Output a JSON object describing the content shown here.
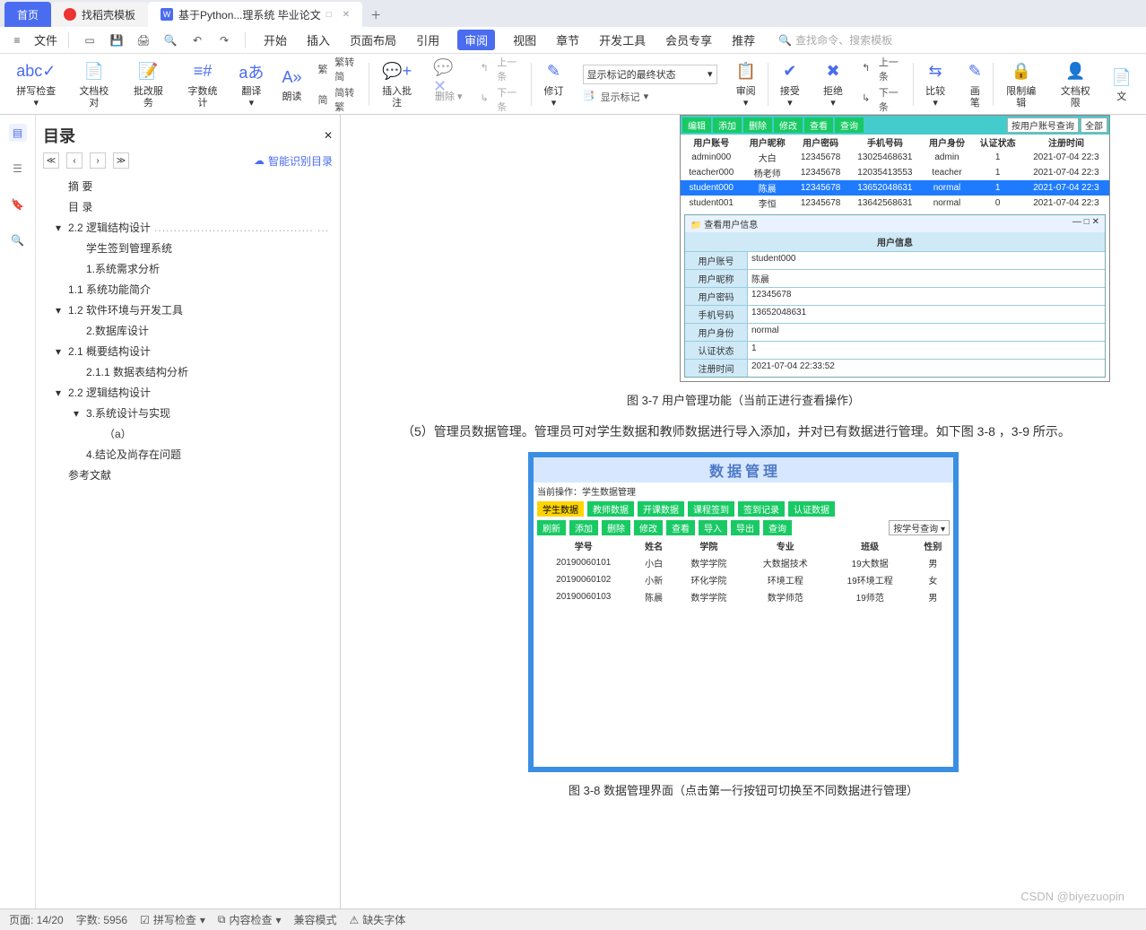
{
  "tabs": {
    "home": "首页",
    "docshell": "找稻壳模板",
    "active": "基于Python...理系统 毕业论文"
  },
  "menubar": {
    "file": "文件",
    "items": [
      "开始",
      "插入",
      "页面布局",
      "引用",
      "审阅",
      "视图",
      "章节",
      "开发工具",
      "会员专享",
      "推荐"
    ],
    "active_index": 4,
    "search_placeholder": "查找命令、搜索模板"
  },
  "ribbon": {
    "g1": "拼写检查",
    "g2": "文档校对",
    "g3": "批改服务",
    "g4": "字数统计",
    "g5": "翻译",
    "g6": "朗读",
    "trad1": "繁转简",
    "trad2": "简转繁",
    "g7": "插入批注",
    "g8": "删除",
    "prev_c": "上一条",
    "next_c": "下一条",
    "g9": "修订",
    "track_dd": "显示标记的最终状态",
    "show_mark": "显示标记",
    "g10": "审阅",
    "g11": "接受",
    "g12": "拒绝",
    "prev_r": "上一条",
    "next_r": "下一条",
    "g13": "比较",
    "g14": "画笔",
    "g15": "限制编辑",
    "g16": "文档权限",
    "g17": "文"
  },
  "outline": {
    "title": "目录",
    "auto": "智能识别目录",
    "items": [
      {
        "lvl": "l0",
        "txt": "摘    要",
        "arr": ""
      },
      {
        "lvl": "l0",
        "txt": "目    录",
        "arr": ""
      },
      {
        "lvl": "l1",
        "txt": "2.2 逻辑结构设计",
        "arr": "▾",
        "dash": true
      },
      {
        "lvl": "l2",
        "txt": "学生签到管理系统",
        "arr": ""
      },
      {
        "lvl": "l2",
        "txt": "1.系统需求分析",
        "arr": ""
      },
      {
        "lvl": "l1",
        "txt": "1.1 系统功能简介",
        "arr": ""
      },
      {
        "lvl": "l1",
        "txt": "1.2 软件环境与开发工具",
        "arr": "▾"
      },
      {
        "lvl": "l2",
        "txt": "2.数据库设计",
        "arr": ""
      },
      {
        "lvl": "l1",
        "txt": "2.1 概要结构设计",
        "arr": "▾"
      },
      {
        "lvl": "l2",
        "txt": "2.1.1 数据表结构分析",
        "arr": ""
      },
      {
        "lvl": "l1",
        "txt": "2.2 逻辑结构设计",
        "arr": "▾"
      },
      {
        "lvl": "l2",
        "txt": "3.系统设计与实现",
        "arr": "▾"
      },
      {
        "lvl": "l3",
        "txt": "（a）",
        "arr": ""
      },
      {
        "lvl": "l2",
        "txt": "4.结论及尚存在问题",
        "arr": ""
      },
      {
        "lvl": "l1",
        "txt": "参考文献",
        "arr": ""
      }
    ]
  },
  "doc": {
    "fig37_caption": "图 3-7  用户管理功能（当前正进行查看操作）",
    "para5": "（5）管理员数据管理。管理员可对学生数据和教师数据进行导入添加，并对已有数据进行管理。如下图 3-8 ，3-9  所示。",
    "fig38_caption": "图 3-8  数据管理界面（点击第一行按钮可切换至不同数据进行管理）"
  },
  "embed1": {
    "toolbar": [
      "编辑",
      "添加",
      "删除",
      "修改",
      "查看",
      "查询"
    ],
    "search_mode": "按用户账号查询",
    "all": "全部",
    "headers": [
      "用户账号",
      "用户昵称",
      "用户密码",
      "手机号码",
      "用户身份",
      "认证状态",
      "注册时间"
    ],
    "rows": [
      [
        "admin000",
        "大白",
        "12345678",
        "13025468631",
        "admin",
        "1",
        "2021-07-04 22:3"
      ],
      [
        "teacher000",
        "杨老师",
        "12345678",
        "12035413553",
        "teacher",
        "1",
        "2021-07-04 22:3"
      ],
      [
        "student000",
        "陈晨",
        "12345678",
        "13652048631",
        "normal",
        "1",
        "2021-07-04 22:3"
      ],
      [
        "student001",
        "李恒",
        "12345678",
        "13642568631",
        "normal",
        "0",
        "2021-07-04 22:3"
      ]
    ],
    "selected_row": 2,
    "dialog_title_bar": "查看用户信息",
    "dialog_title": "用户信息",
    "fields": [
      [
        "用户账号",
        "student000"
      ],
      [
        "用户昵称",
        "陈晨"
      ],
      [
        "用户密码",
        "12345678"
      ],
      [
        "手机号码",
        "13652048631"
      ],
      [
        "用户身份",
        "normal"
      ],
      [
        "认证状态",
        "1"
      ],
      [
        "注册时间",
        "2021-07-04 22:33:52"
      ]
    ]
  },
  "embed2": {
    "banner": "数 据 管 理",
    "info": "当前操作：学生数据管理",
    "tabs": [
      "学生数据",
      "教师数据",
      "开课数据",
      "课程签到",
      "签到记录",
      "认证数据"
    ],
    "ops": [
      "刷新",
      "添加",
      "删除",
      "修改",
      "查看",
      "导入",
      "导出",
      "查询"
    ],
    "search_mode": "按学号查询",
    "headers": [
      "学号",
      "姓名",
      "学院",
      "专业",
      "班级",
      "性别"
    ],
    "rows": [
      [
        "20190060101",
        "小白",
        "数学学院",
        "大数据技术",
        "19大数据",
        "男"
      ],
      [
        "20190060102",
        "小新",
        "环化学院",
        "环境工程",
        "19环境工程",
        "女"
      ],
      [
        "20190060103",
        "陈晨",
        "数学学院",
        "数学师范",
        "19师范",
        "男"
      ]
    ]
  },
  "status": {
    "page": "页面: 14/20",
    "words": "字数: 5956",
    "spell": "拼写检查",
    "content": "内容检查",
    "compat": "兼容模式",
    "missing": "缺失字体"
  },
  "watermark": "CSDN @biyezuopin"
}
